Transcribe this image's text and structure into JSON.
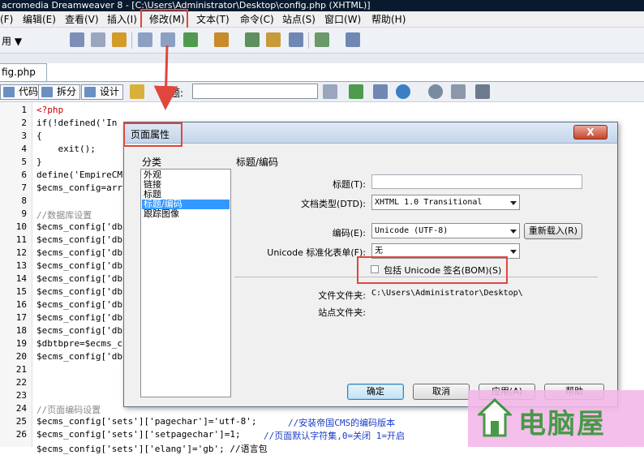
{
  "window": {
    "title": "acromedia Dreamweaver 8 - [C:\\Users\\Administrator\\Desktop\\config.php (XHTML)]"
  },
  "menubar": {
    "items": [
      "(F)",
      "编辑(E)",
      "查看(V)",
      "插入(I)",
      "修改(M)",
      "文本(T)",
      "命令(C)",
      "站点(S)",
      "窗口(W)",
      "帮助(H)"
    ]
  },
  "toolbar": {
    "mode_label": "用 ▼"
  },
  "file_tab": {
    "label": "fig.php"
  },
  "doc_toolbar": {
    "code_label": "代码",
    "split_label": "拆分",
    "design_label": "设计",
    "title_label": "标题:"
  },
  "code": {
    "line_numbers": [
      "1",
      "2",
      "3",
      "4",
      "5",
      "6",
      "7",
      "8",
      "9",
      "10",
      "11",
      "12",
      "13",
      "14",
      "15",
      "16",
      "17",
      "18",
      "19",
      "20",
      "21",
      "22",
      "23",
      "24",
      "25",
      "26"
    ],
    "lines": [
      "<?php",
      "if(!defined('In",
      "{",
      "    exit();",
      "}",
      "define('EmpireCM",
      "$ecms_config=arr",
      "",
      "//数据库设置",
      "$ecms_config['db",
      "$ecms_config['db",
      "$ecms_config['db",
      "$ecms_config['db",
      "$ecms_config['db",
      "$ecms_config['db",
      "$ecms_config['db",
      "$ecms_config['db",
      "$ecms_config['db",
      "$dbtbpre=$ecms_c",
      "$ecms_config['db",
      "",
      "",
      "",
      "//页面编码设置",
      "$ecms_config['sets']['pagechar']='utf-8';",
      "$ecms_config['sets']['setpagechar']=1;"
    ],
    "comment_25": "//安装帝国CMS的编码版本",
    "comment_26": "//页面默认字符集,0=关闭 1=开启",
    "partial_27": "$ecms_config['sets']['elang']='gb'; //语言包"
  },
  "dialog": {
    "title": "页面属性",
    "close_label": "X",
    "category_label": "分类",
    "categories": [
      "外观",
      "链接",
      "标题",
      "标题/编码",
      "跟踪图像"
    ],
    "selected_index": 3,
    "section_title": "标题/编码",
    "fields": {
      "title_label": "标题(T):",
      "doctype_label": "文档类型(DTD):",
      "doctype_value": "XHTML 1.0 Transitional",
      "encoding_label": "编码(E):",
      "encoding_value": "Unicode (UTF-8)",
      "reload_button": "重新载入(R)",
      "normalization_label": "Unicode 标准化表单(F):",
      "normalization_value": "无",
      "bom_label": "包括 Unicode 签名(BOM)(S)",
      "bom_checked": false,
      "doc_folder_label": "文件文件夹:",
      "doc_folder_value": "C:\\Users\\Administrator\\Desktop\\",
      "site_folder_label": "站点文件夹:",
      "site_folder_value": ""
    },
    "buttons": {
      "ok": "确定",
      "cancel": "取消",
      "apply": "应用(A)",
      "help": "帮助"
    }
  },
  "watermark": {
    "text": "电脑屋"
  },
  "colors": {
    "annotation_red": "#e0463d",
    "selection_blue": "#3399ff",
    "watermark_green": "#2e8b2e"
  }
}
